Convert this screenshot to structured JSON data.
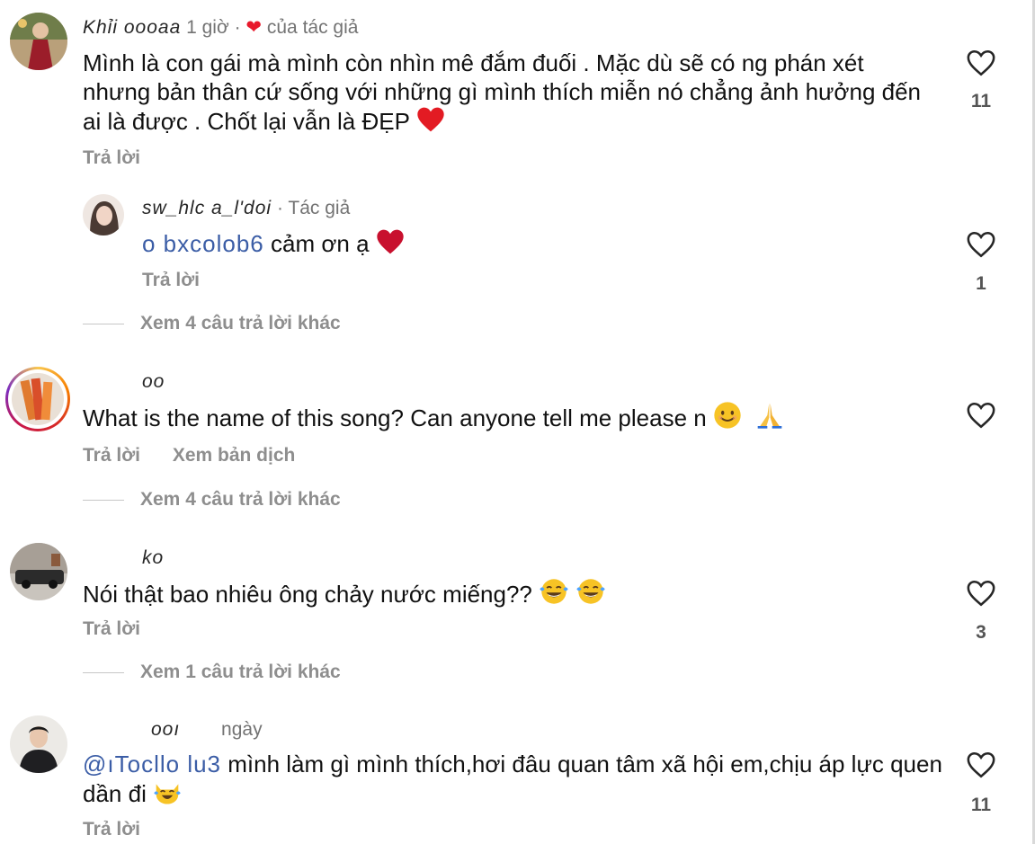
{
  "colors": {
    "like_heart": "#e8192c",
    "mention": "#3b5da6",
    "muted": "#8e8e8e"
  },
  "comments": [
    {
      "username": "Khỉi oooaa",
      "time": "1 giờ",
      "liked_badge": "của tác giả",
      "text": "Mình là con gái mà mình còn nhìn mê đắm đuối . Mặc dù sẽ có ng phán xét nhưng bản thân cứ sống với những gì mình thích miễn nó chẳng ảnh hưởng đến ai là được . Chốt lại vẫn là ĐẸP",
      "emoji": "red-heart",
      "reply_label": "Trả lời",
      "like_count": "11",
      "icon": "heart-outline-icon"
    },
    {
      "username": "sw_hlc a_l'doi",
      "author_badge": "· Tác giả",
      "mention": "o bxcolob6",
      "text": "cảm ơn ạ",
      "emoji": "red-heart",
      "reply_label": "Trả lời",
      "like_count": "1",
      "view_more": "Xem 4 câu trả lời khác"
    },
    {
      "username": "oo",
      "text": "What is the name of this song? Can anyone tell me please n",
      "emoji": [
        "smiling-face",
        "folded-hands"
      ],
      "reply_label": "Trả lời",
      "translate_label": "Xem bản dịch",
      "view_more": "Xem 4 câu trả lời khác"
    },
    {
      "username": "ko",
      "text": "Nói thật bao nhiêu ông chảy nước miếng??",
      "emoji": [
        "face-with-tears-of-joy",
        "face-with-tears-of-joy"
      ],
      "reply_label": "Trả lời",
      "like_count": "3",
      "view_more": "Xem 1 câu trả lời khác"
    },
    {
      "username": "ooı",
      "time": "ngày",
      "mention": "@ıTocllo lu3",
      "text": "mình làm gì mình thích,hơi đâu quan tâm xã hội em,chịu áp lực quen dần đi",
      "emoji": "cat-with-tears-of-joy",
      "reply_label": "Trả lời",
      "like_count": "11"
    }
  ]
}
